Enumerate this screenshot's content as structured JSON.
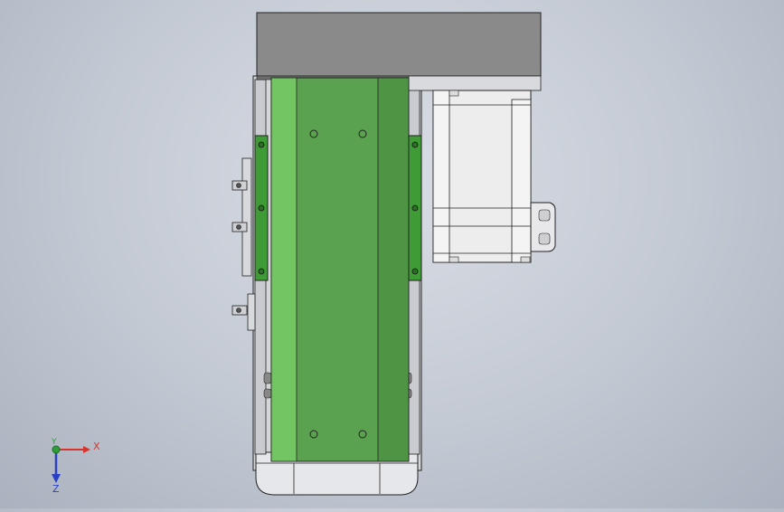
{
  "viewport": {
    "background_top": "#d9dde5",
    "background_bottom": "#aab2bf"
  },
  "model": {
    "carriage_color": "#5aa24f",
    "carriage_light": "#72c562",
    "rail_bracket_color": "#3f9b35",
    "housing_color": "#8a8a8a",
    "motor_color": "#ececec",
    "outline_color": "#222222"
  },
  "triad": {
    "x_label": "X",
    "y_label": "Y",
    "z_label": "Z",
    "x_color": "#d9342b",
    "y_color": "#2f9e3a",
    "z_color": "#2a3fc4"
  }
}
